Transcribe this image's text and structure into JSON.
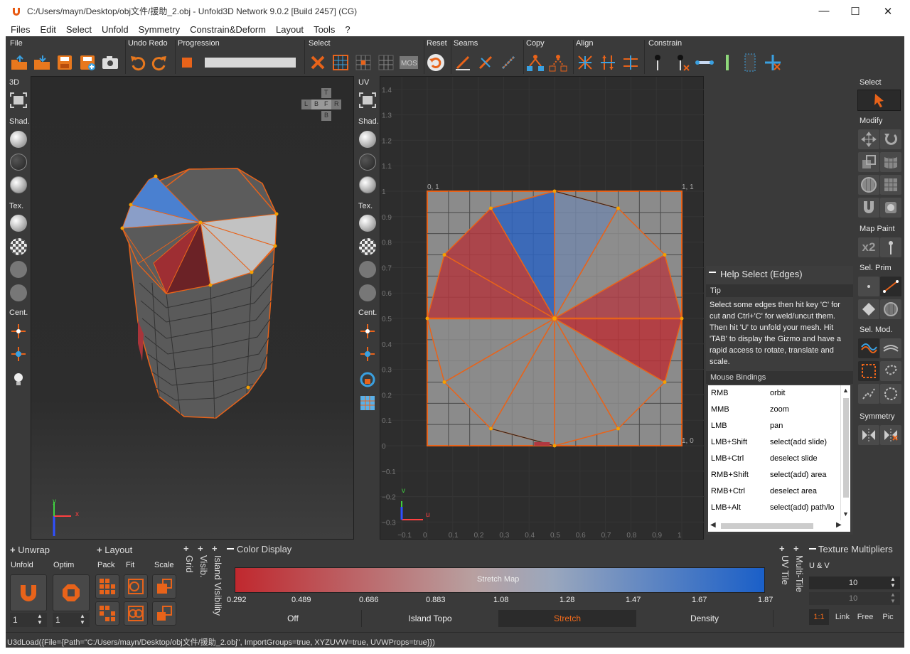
{
  "window": {
    "title": "C:/Users/mayn/Desktop/obj文件/援助_2.obj - Unfold3D Network 9.0.2 [Build 2457] (CG)",
    "minimize": "—",
    "maximize": "☐",
    "close": "✕"
  },
  "menu": [
    "Files",
    "Edit",
    "Select",
    "Unfold",
    "Symmetry",
    "Constrain&Deform",
    "Layout",
    "Tools",
    "?"
  ],
  "toolbar": {
    "file": "File",
    "undo_redo": "Undo Redo",
    "progression": "Progression",
    "select": "Select",
    "reset": "Reset",
    "seams": "Seams",
    "copy": "Copy",
    "align": "Align",
    "constrain": "Constrain"
  },
  "left_side": {
    "view3d": "3D",
    "shad": "Shad.",
    "tex": "Tex.",
    "cent": "Cent."
  },
  "uv_side": {
    "uv": "UV",
    "shad": "Shad.",
    "tex": "Tex.",
    "cent": "Cent."
  },
  "viewcube": {
    "t": "T",
    "b": "B",
    "l": "L",
    "f": "F",
    "r": "R",
    "bt": "B"
  },
  "axes3d": {
    "y": "y",
    "x": "x"
  },
  "axes_uv": {
    "v": "v",
    "u": "u"
  },
  "uv_yticks": [
    "1.4",
    "1.3",
    "1.2",
    "1.1",
    "1",
    "0.9",
    "0.8",
    "0.7",
    "0.6",
    "0.5",
    "0.4",
    "0.3",
    "0.2",
    "0.1",
    "0",
    "−0.1",
    "−0.2",
    "−0.3"
  ],
  "uv_xticks": [
    "−0.1",
    "0",
    "0.1",
    "0.2",
    "0.3",
    "0.4",
    "0.5",
    "0.6",
    "0.7",
    "0.8",
    "0.9",
    "1"
  ],
  "uv_corners": {
    "tl": "0, 1",
    "tr": "1, 1",
    "br": "1, 0"
  },
  "right_panel": {
    "select": "Select",
    "modify": "Modify",
    "map_paint": "Map Paint",
    "x2": "x2",
    "sel_prim": "Sel. Prim",
    "sel_mod": "Sel. Mod.",
    "symmetry": "Symmetry"
  },
  "help": {
    "title": "Help Select (Edges)",
    "tip_label": "Tip",
    "tip_text": "Select some edges then hit key 'C' for cut and Ctrl+'C' for weld/uncut them. Then hit 'U' to unfold your mesh. Hit 'TAB' to display the Gizmo and have a rapid access to rotate, translate and scale.",
    "mouse_label": "Mouse Bindings",
    "bindings": [
      {
        "key": "RMB",
        "action": "orbit"
      },
      {
        "key": "MMB",
        "action": "zoom"
      },
      {
        "key": "LMB",
        "action": "pan"
      },
      {
        "key": "LMB+Shift",
        "action": "select(add slide)"
      },
      {
        "key": "LMB+Ctrl",
        "action": "deselect slide"
      },
      {
        "key": "RMB+Shift",
        "action": "select(add) area"
      },
      {
        "key": "RMB+Ctrl",
        "action": "deselect area"
      },
      {
        "key": "LMB+Alt",
        "action": "select(add) path/lo"
      }
    ]
  },
  "bottom": {
    "unwrap": "Unwrap",
    "unfold": "Unfold",
    "optim": "Optim",
    "unfold_val": "1",
    "optim_val": "1",
    "layout": "Layout",
    "pack": "Pack",
    "fit": "Fit",
    "scale": "Scale",
    "grid": "Grid",
    "visib": "Visib.",
    "island_visibility": "Island Visibility",
    "color_display": "Color Display",
    "stretch_map": "Stretch Map",
    "stretch_ticks": [
      "0.292",
      "0.489",
      "0.686",
      "0.883",
      "1.08",
      "1.28",
      "1.47",
      "1.67",
      "1.87"
    ],
    "tabs": [
      "Off",
      "Island Topo",
      "Stretch",
      "Density"
    ],
    "uv_tile": "UV Tile",
    "multi_tile": "Multi-Tile",
    "texture_multipliers": "Texture Multipliers",
    "uv_label": "U & V",
    "mult_val1": "10",
    "mult_val2": "10",
    "ratio": "1:1",
    "link": "Link",
    "free": "Free",
    "pic": "Pic"
  },
  "status": "U3dLoad({File={Path=\"C:/Users/mayn/Desktop/obj文件/援助_2.obj\", ImportGroups=true, XYZUVW=true, UVWProps=true}})",
  "colors": {
    "accent": "#f26a1b",
    "stretch_low": "#c0282e",
    "stretch_high": "#1a5fc8"
  }
}
